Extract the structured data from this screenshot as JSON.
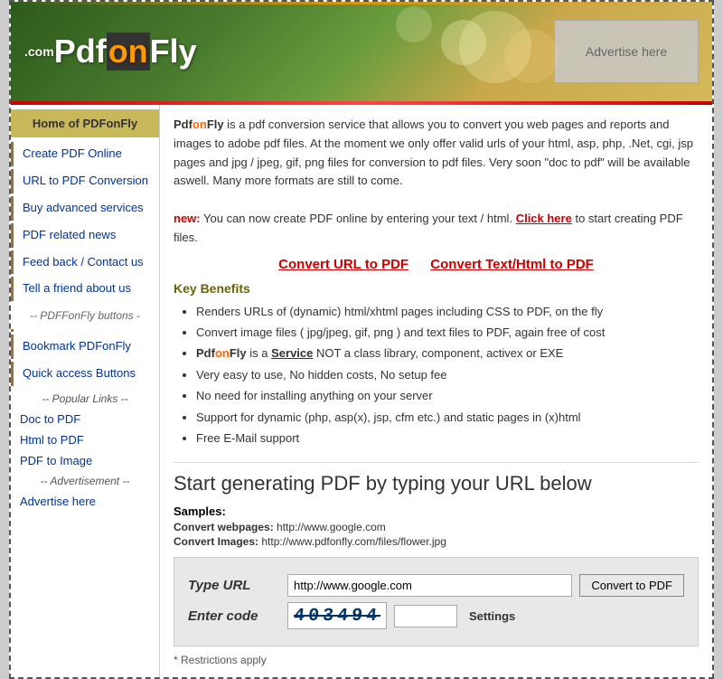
{
  "header": {
    "logo_com": ".com",
    "logo_pdf": "Pdf",
    "logo_on": "on",
    "logo_fly": "Fly",
    "ad_text": "Advertise here"
  },
  "sidebar": {
    "home_label": "Home of PDFonFly",
    "items": [
      {
        "id": "create-pdf",
        "label": "Create PDF Online"
      },
      {
        "id": "url-to-pdf",
        "label": "URL to PDF Conversion"
      },
      {
        "id": "buy-advanced",
        "label": "Buy advanced services"
      },
      {
        "id": "pdf-news",
        "label": "PDF related news"
      },
      {
        "id": "feedback",
        "label": "Feed back / Contact us"
      },
      {
        "id": "tell-friend",
        "label": "Tell a friend about us"
      },
      {
        "id": "buttons",
        "label": "-- PDFFonFly buttons -"
      },
      {
        "id": "bookmark",
        "label": "Bookmark PDFonFly"
      },
      {
        "id": "quick-access",
        "label": "Quick access Buttons"
      }
    ],
    "popular_label": "-- Popular Links --",
    "link_items": [
      {
        "id": "doc-to-pdf",
        "label": "Doc to PDF"
      },
      {
        "id": "html-to-pdf",
        "label": "Html to PDF"
      },
      {
        "id": "pdf-to-image",
        "label": "PDF to Image"
      }
    ],
    "ad_section": "-- Advertisement --",
    "advertise": "Advertise here"
  },
  "content": {
    "intro": "PdfonFly is a pdf conversion service that allows you to convert you web pages and reports and images to adobe pdf files. At the moment we only offer valid urls of your html, asp, php, .Net, cgi, jsp pages and jpg / jpeg, gif, png files for conversion to pdf files. Very soon \"doc to pdf\" will be available aswell. Many more formats are still to come.",
    "new_label": "new:",
    "new_text": "You can now create PDF online by entering your text / html.",
    "click_here": "Click here",
    "click_here_suffix": "to start creating PDF files.",
    "convert_url_link": "Convert URL to PDF",
    "convert_text_link": "Convert Text/Html to PDF",
    "key_benefits_title": "Key Benefits",
    "benefits": [
      "Renders URLs of (dynamic) html/xhtml pages including CSS to PDF, on the fly",
      "Convert image files ( jpg/jpeg, gif, png ) and text files to PDF, again free of cost",
      "PdfonFly is a Service NOT a class library, component, activex or EXE",
      "Very easy to use, No hidden costs, No setup fee",
      "No need for installing anything on your server",
      "Support for dynamic (php, asp(x), jsp, cfm etc.) and static pages in (x)html",
      "Free E-Mail support"
    ],
    "benefits_bold": [
      "PdfonFly",
      "Service"
    ],
    "url_section_title": "Start generating PDF by typing your URL below",
    "samples_label": "Samples:",
    "sample_webpages_label": "Convert webpages:",
    "sample_webpages_url": "http://www.google.com",
    "sample_images_label": "Convert Images:",
    "sample_images_url": "http://www.pdfonfly.com/files/flower.jpg",
    "form": {
      "url_label": "Type URL",
      "url_placeholder": "http://www.google.com",
      "url_value": "http://www.google.com",
      "convert_btn": "Convert to PDF",
      "code_label": "Enter code",
      "captcha_value": "403494",
      "settings_label": "Settings"
    },
    "restrictions": "* Restrictions apply"
  }
}
